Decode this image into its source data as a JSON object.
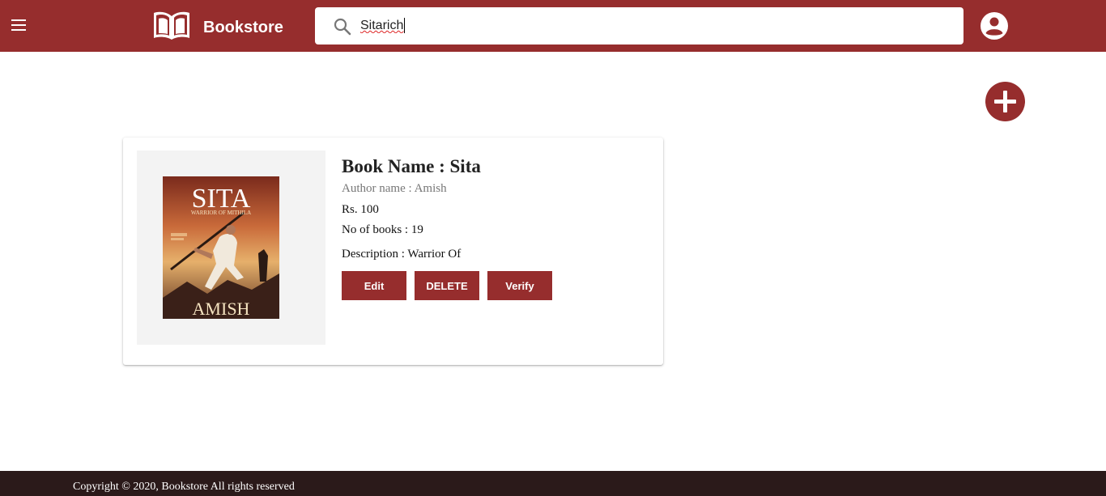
{
  "header": {
    "brand": "Bookstore",
    "search_value": "Sitarich"
  },
  "book": {
    "name_line": "Book Name : Sita",
    "author_line": "Author name : Amish",
    "price_line": "Rs. 100",
    "count_line": "No of books : 19",
    "description_line": "Description : Warrior Of",
    "cover": {
      "title": "SITA",
      "subtitle": "WARRIOR OF MITHILA",
      "author": "AMISH"
    }
  },
  "actions": {
    "edit": "Edit",
    "delete": "DELETE",
    "verify": "Verify"
  },
  "footer": {
    "copyright": "Copyright © 2020, Bookstore All rights reserved"
  },
  "colors": {
    "primary": "#962d2d",
    "footer": "#2b1a1a"
  },
  "icons": {
    "menu": "menu-icon",
    "logo": "open-book-icon",
    "search": "search-icon",
    "account": "account-circle-icon",
    "add": "add-circle-icon"
  }
}
